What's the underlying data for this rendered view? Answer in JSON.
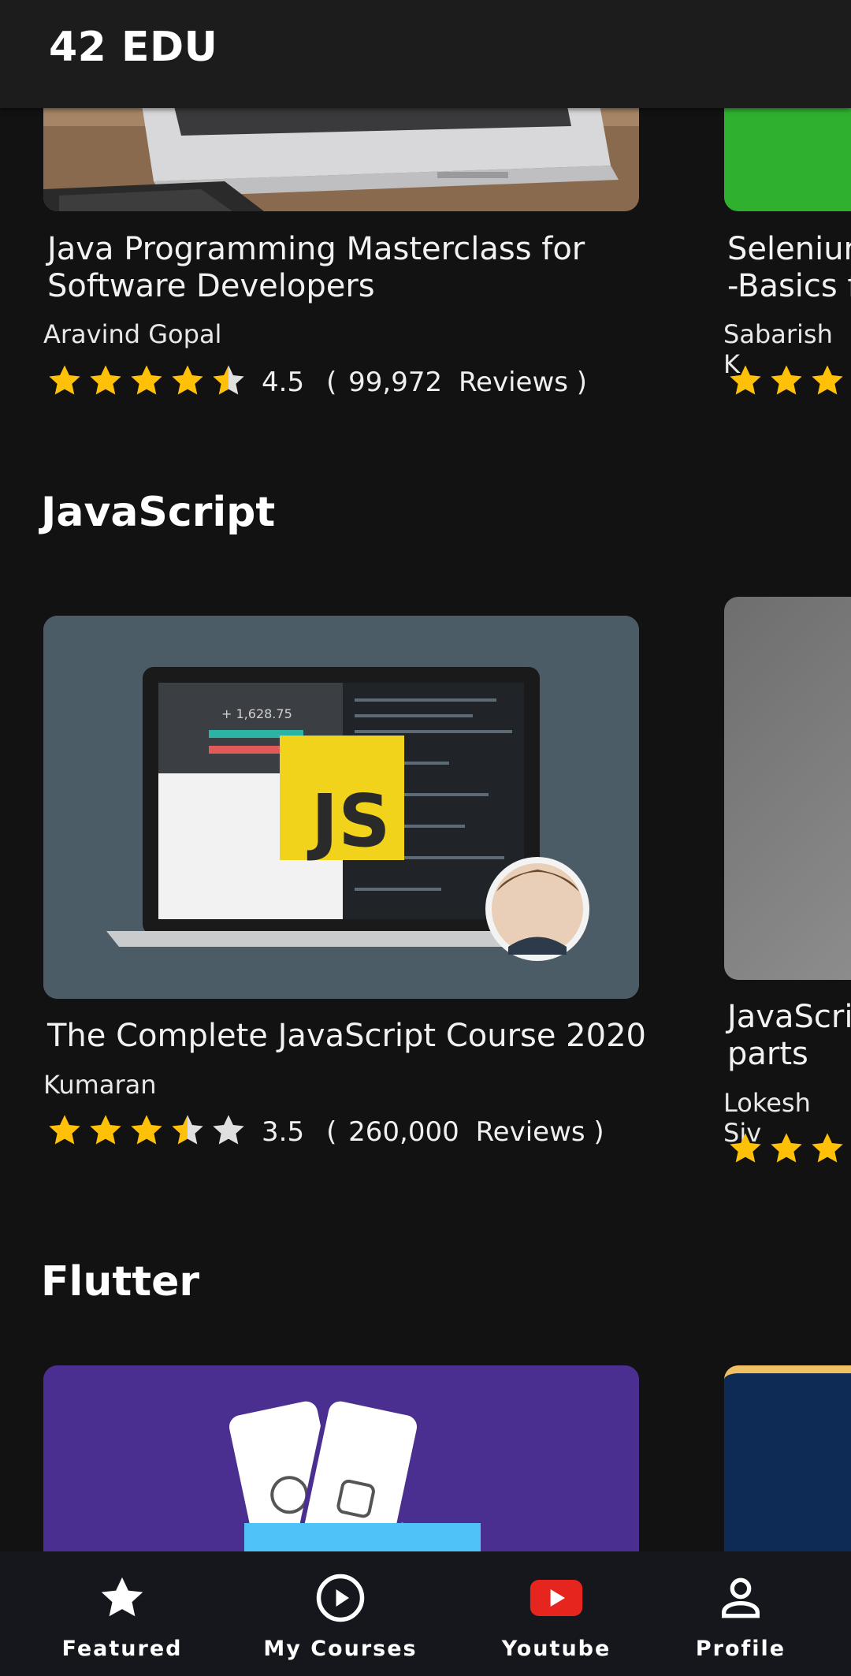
{
  "app": {
    "title": "42 EDU"
  },
  "colors": {
    "accent_star": "#FFC107",
    "empty_star": "#E0E0E0",
    "youtube_red": "#E5251E"
  },
  "sections": [
    {
      "title": "JavaScript",
      "courses": [
        {
          "title_lines": [
            "The Complete JavaScript Course 2020"
          ],
          "author": "Kumaran",
          "rating": "3.5",
          "rating_value": 3.5,
          "reviews_count": "260,000",
          "reviews_word": "Reviews"
        },
        {
          "title_lines": [
            "JavaScri",
            "parts"
          ],
          "author": "Lokesh Siv",
          "rating_value": 3
        }
      ]
    },
    {
      "title": "Flutter",
      "courses": []
    }
  ],
  "top_row": [
    {
      "title_lines": [
        "Java Programming Masterclass for",
        "Software Developers"
      ],
      "author": "Aravind Gopal",
      "rating": "4.5",
      "rating_value": 4.5,
      "reviews_count": "99,972",
      "reviews_word": "Reviews"
    },
    {
      "title_lines": [
        "Seleniur",
        "-Basics f"
      ],
      "author": "Sabarish K",
      "rating_value": 3
    }
  ],
  "thumb_text": {
    "js_badge": "JS",
    "price": "+ 1,628.75"
  },
  "bottom_nav": [
    {
      "label": "Featured",
      "icon": "star-icon"
    },
    {
      "label": "My Courses",
      "icon": "play-circle-icon"
    },
    {
      "label": "Youtube",
      "icon": "youtube-icon"
    },
    {
      "label": "Profile",
      "icon": "person-icon"
    }
  ]
}
